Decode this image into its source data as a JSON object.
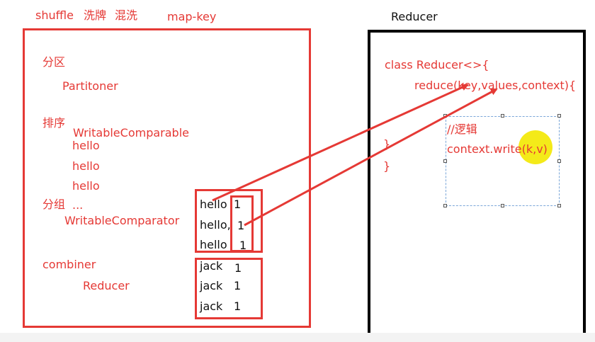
{
  "header": {
    "shuffle": "shuffle",
    "xipai": "洗牌",
    "hunxi": "混洗",
    "map_key": "map-key",
    "reducer_title": "Reducer"
  },
  "map_panel": {
    "partition_heading": "分区",
    "partition_class": "Partitoner",
    "sort_heading": "排序",
    "sort_class": "WritableComparable",
    "sort_values": [
      "hello",
      "hello",
      "hello"
    ],
    "group_heading": "分组",
    "group_ellipsis": "...",
    "group_class": "WritableComparator",
    "combiner_heading": "combiner",
    "combiner_class": "Reducer"
  },
  "grouped_box": {
    "rows": [
      {
        "key": "hello",
        "value": "1"
      },
      {
        "key": "hello,",
        "value": "1"
      },
      {
        "key": "hello",
        "value": "1"
      }
    ]
  },
  "jack_box": {
    "rows": [
      {
        "key": "jack",
        "value": "1"
      },
      {
        "key": "jack",
        "value": "1"
      },
      {
        "key": "jack",
        "value": "1"
      }
    ]
  },
  "reducer_panel": {
    "class_line": "class Reducer<>{",
    "method_line": "reduce(key,values,context){",
    "close_inner": "}",
    "close_outer": "}",
    "comment": "//逻辑",
    "write_call": "context.write(k,v)"
  },
  "colors": {
    "annotation_red": "#e53935",
    "panel_black": "#000000",
    "cursor_yellow": "#f4ea19"
  }
}
